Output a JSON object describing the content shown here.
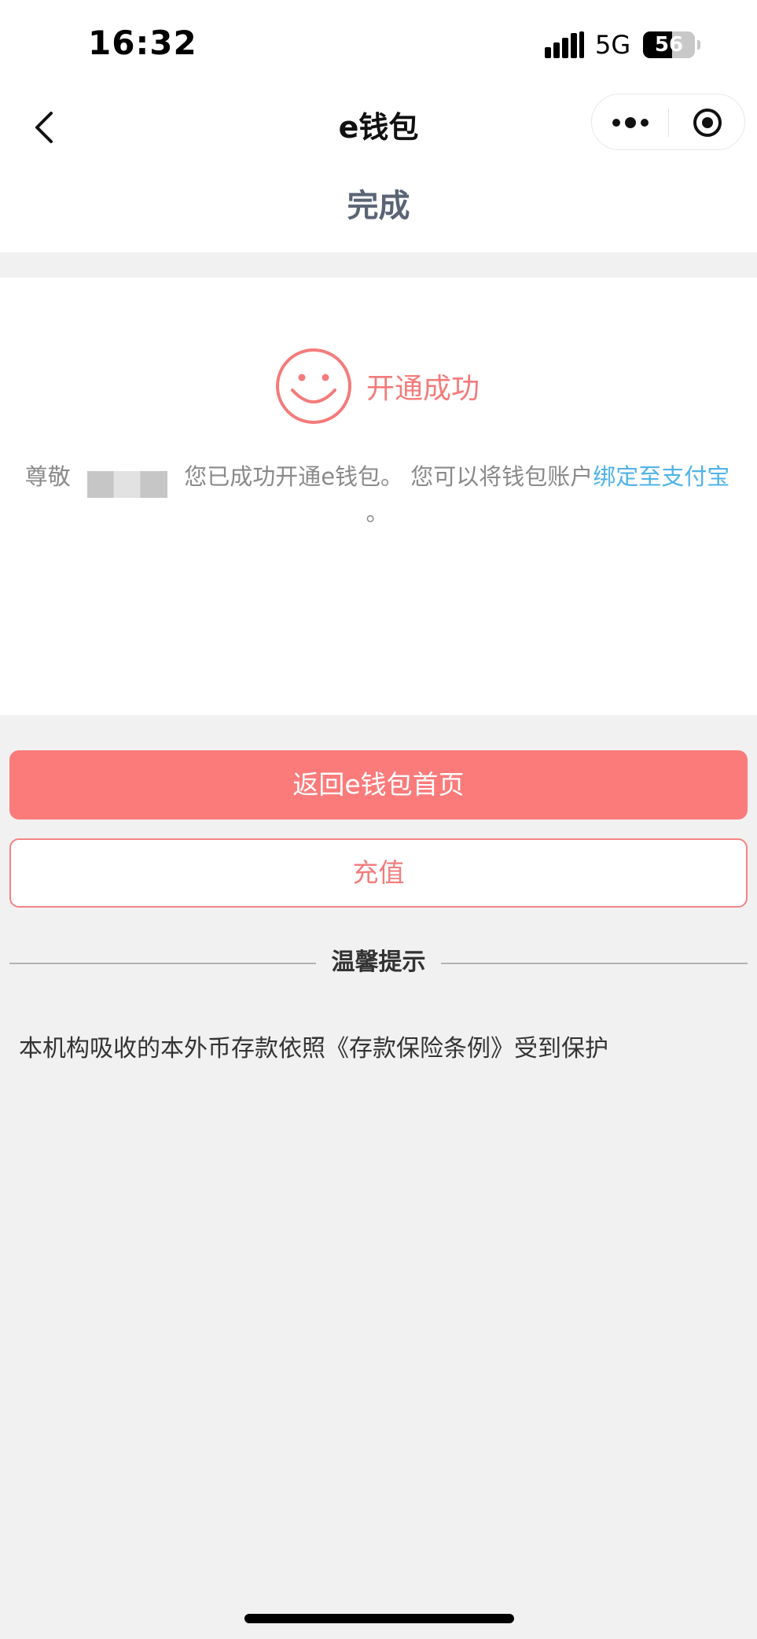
{
  "status_bar": {
    "time": "16:32",
    "network": "5G",
    "battery": "56",
    "battery_level": 0.56,
    "icons": [
      "signal-icon",
      "battery-icon"
    ]
  },
  "nav": {
    "title": "e钱包",
    "icons": [
      "back-arrow-icon",
      "more-dots-icon",
      "close-target-icon"
    ]
  },
  "header": {
    "title": "完成"
  },
  "result": {
    "status_text": "开通成功",
    "icon": "smiley-face-icon",
    "greeting": "尊敬",
    "message_part1": "您已成功开通e钱包。 您可以将钱包账户",
    "link_text": "绑定至支付宝",
    "message_end": " 。"
  },
  "actions": {
    "primary_label": "返回e钱包首页",
    "secondary_label": "充值"
  },
  "tips": {
    "title": "温馨提示",
    "text": "本机构吸收的本外币存款依照《存款保险条例》受到保护"
  },
  "colors": {
    "accent": "#fb7b7b",
    "link": "#4fb3e8",
    "background": "#f1f1f1"
  }
}
